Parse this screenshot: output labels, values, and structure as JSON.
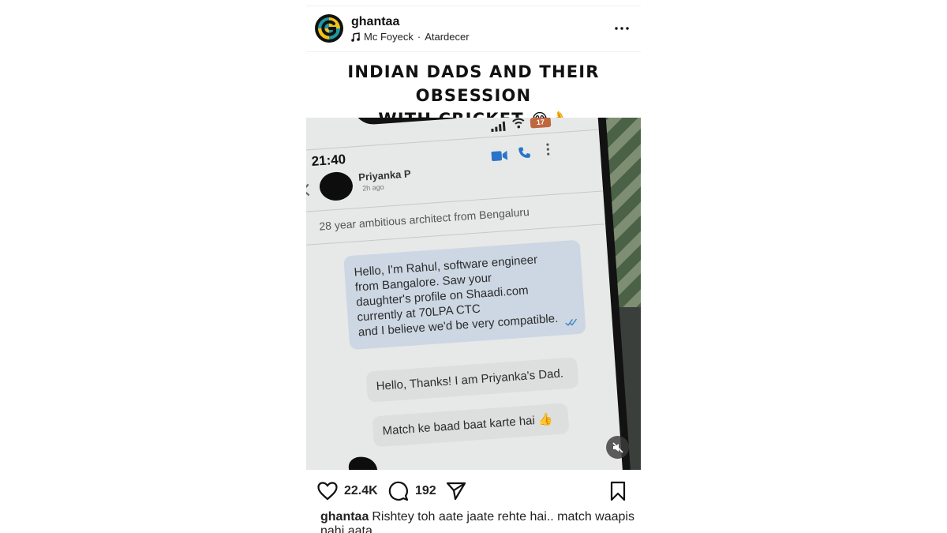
{
  "post": {
    "username": "ghantaa",
    "audio": {
      "artist": "Mc Foyeck",
      "separator": " · ",
      "track": "Atardecer"
    },
    "headline": {
      "line1": "INDIAN DADS AND THEIR OBSESSION",
      "line2": "WITH CRICKET",
      "emojis": "😂👌"
    },
    "media": {
      "status_time": "21:40",
      "battery": "17",
      "contact_name": "Priyanka P",
      "contact_last_seen": "2h ago",
      "bio": "28 year ambitious architect from Bengaluru",
      "messages": {
        "sent": [
          "Hello, I'm Rahul, software engineer",
          "from Bangalore. Saw your",
          "daughter's profile on Shaadi.com",
          "currently at 70LPA CTC",
          "and I believe we'd be very compatible."
        ],
        "received_1": "Hello, Thanks! I am Priyanka's Dad.",
        "received_2": "Match ke baad baat karte hai 👍"
      }
    },
    "actions": {
      "likes": "22.4K",
      "comments": "192"
    },
    "caption": {
      "username": "ghantaa",
      "text": "Rishtey toh aate jaate rehte hai.. match waapis nahi aata"
    }
  },
  "icons": {
    "avatar": "ghantaa-logo-icon",
    "audio": "music-note-icon",
    "more": "more-options-icon",
    "mute": "muted-speaker-icon",
    "like": "heart-icon",
    "comment": "comment-bubble-icon",
    "share": "paper-plane-icon",
    "save": "bookmark-icon"
  },
  "colors": {
    "brand_yellow": "#f2c11b",
    "brand_teal": "#1c9aa6",
    "sent_bubble": "#cdd7e3",
    "received_bubble": "#dddfde",
    "battery": "#c0663e"
  }
}
